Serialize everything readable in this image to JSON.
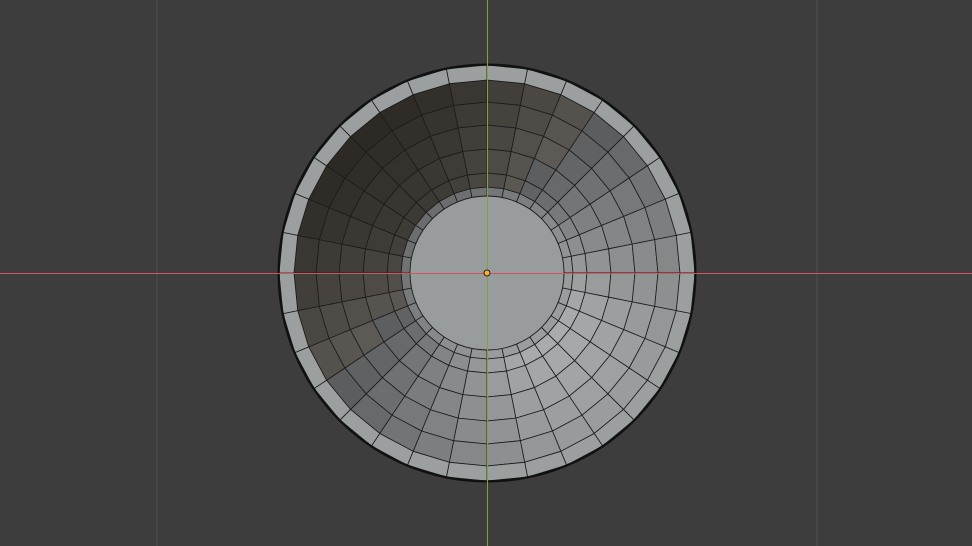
{
  "viewport": {
    "view": "top-orthographic",
    "background_color": "#3d3d3d",
    "grid_line_color": "#505050",
    "x_axis_color": "#d0555f",
    "y_axis_color": "#7fa343",
    "mesh": {
      "object": "bowl",
      "segments": 32,
      "edge_color": "#1b1b1b",
      "outline_color": "#111111",
      "flat_face_color": "#999c9c",
      "rim_face_color": "#9c9f9f",
      "inner_ring_color": "#8c8f8f"
    },
    "origin": {
      "marker": "object-origin-icon",
      "fill_color": "#ffae2e",
      "stroke_color": "#222222"
    }
  }
}
